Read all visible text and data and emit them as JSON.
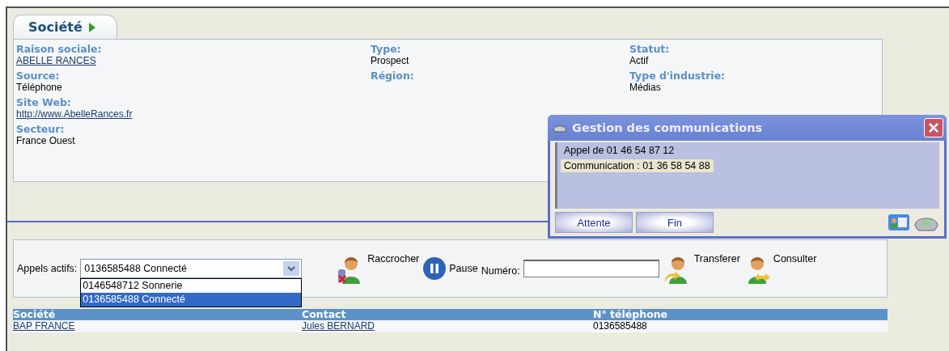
{
  "tab": {
    "label": "Société"
  },
  "columns": [
    [
      {
        "label": "Raison sociale:",
        "value": "ABELLE RANCES",
        "kind": "link"
      },
      {
        "label": "Source:",
        "value": "Téléphone",
        "kind": "text"
      },
      {
        "label": "Site Web:",
        "value": "http://www.AbelleRances.fr",
        "kind": "link"
      },
      {
        "label": "Secteur:",
        "value": "France Ouest",
        "kind": "text"
      }
    ],
    [
      {
        "label": "Type:",
        "value": "Prospect",
        "kind": "text"
      },
      {
        "label": "Région:"
      }
    ],
    [
      {
        "label": "Statut:",
        "value": "Actif",
        "kind": "text"
      },
      {
        "label": "Type d'industrie:",
        "value": "Médias",
        "kind": "text"
      }
    ]
  ],
  "popup": {
    "title": "Gestion des communications",
    "lines": [
      {
        "text": "Appel de 01 46 54 87 12",
        "selected": false
      },
      {
        "text": "Communication : 01 36 58 54 88",
        "selected": true
      }
    ],
    "buttons": [
      "Attente",
      "Fin"
    ]
  },
  "toolbar": {
    "label": "Appels actifs:",
    "select_value": "0136585488 Connecté",
    "options": [
      {
        "text": "0146548712 Sonnerie",
        "selected": false
      },
      {
        "text": "0136585488 Connecté",
        "selected": true
      }
    ],
    "actions": [
      {
        "kind": "hangup",
        "label": "Raccrocher"
      },
      {
        "kind": "pause",
        "label": "Pause"
      }
    ],
    "number_label": "Numéro:",
    "actions2": [
      {
        "kind": "transfer",
        "label": "Transferer"
      },
      {
        "kind": "consult",
        "label": "Consulter"
      }
    ]
  },
  "table": {
    "columns": [
      "Société",
      "Contact",
      "N° téléphone"
    ],
    "rows": [
      [
        {
          "text": "BAP FRANCE",
          "kind": "link"
        },
        {
          "text": "Jules BERNARD",
          "kind": "link"
        },
        {
          "text": "0136585488",
          "kind": "text"
        }
      ]
    ]
  }
}
